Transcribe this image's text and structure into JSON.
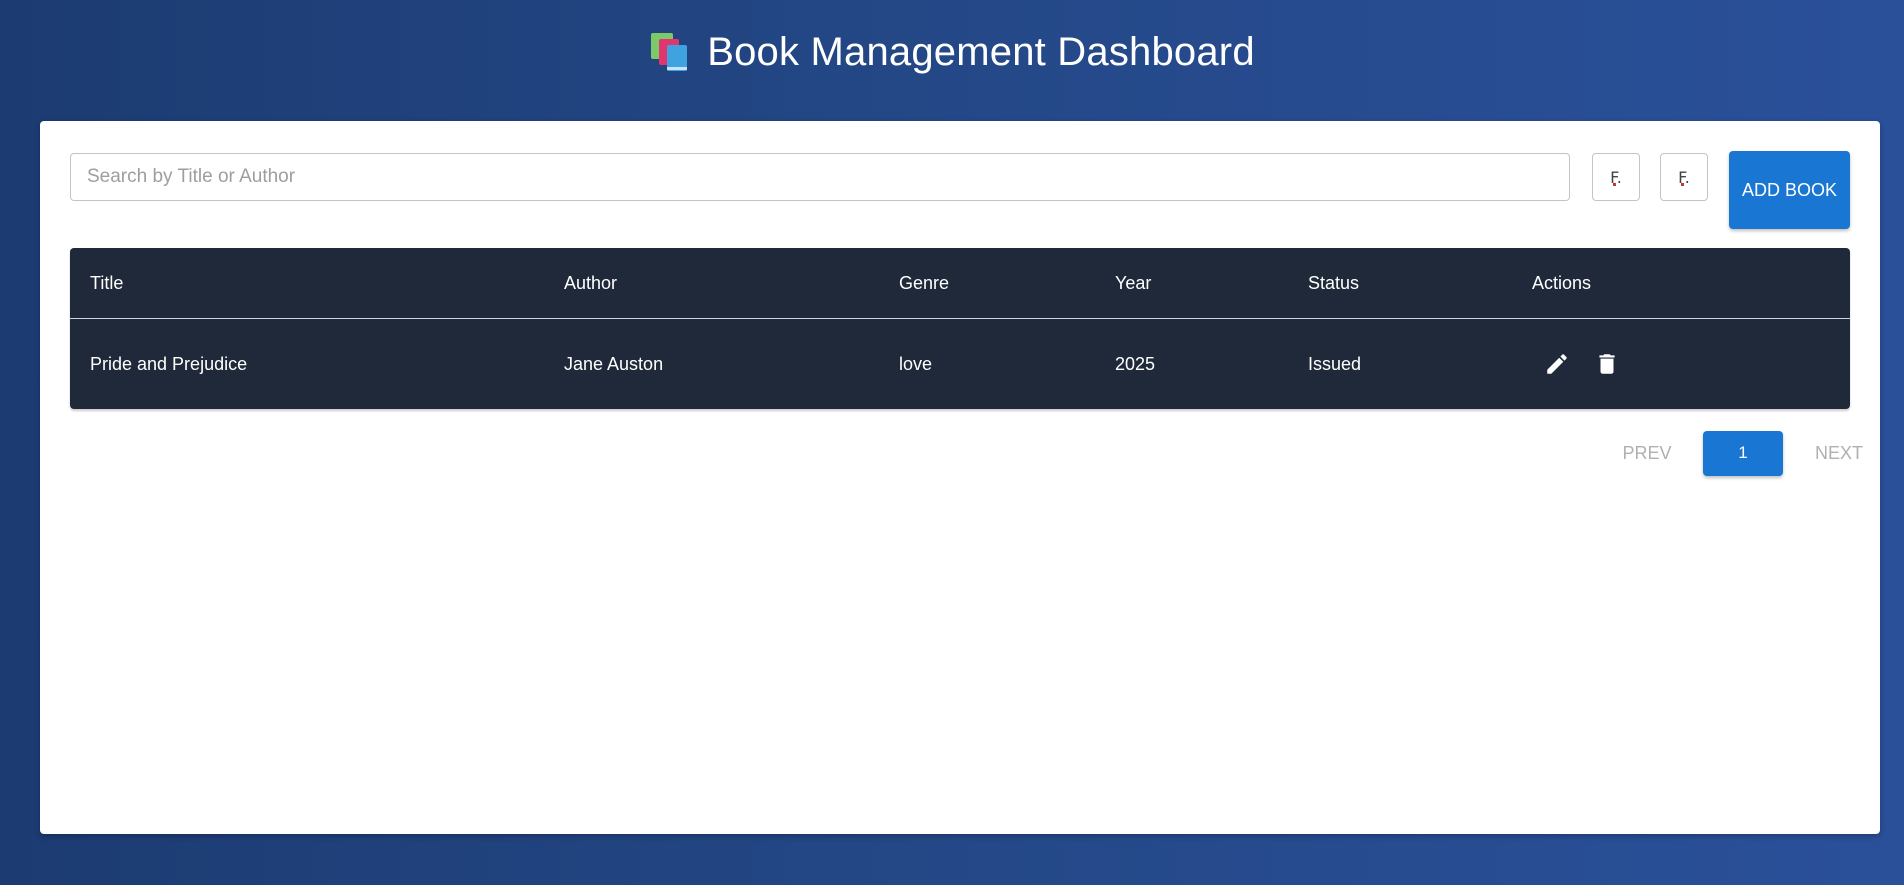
{
  "header": {
    "title": "Book Management Dashboard",
    "icon": "books-icon"
  },
  "toolbar": {
    "search_placeholder": "Search by Title or Author",
    "search_value": "",
    "filter1_label": "F.",
    "filter2_label": "F.",
    "add_label": "ADD BOOK"
  },
  "table": {
    "columns": [
      "Title",
      "Author",
      "Genre",
      "Year",
      "Status",
      "Actions"
    ],
    "rows": [
      {
        "title": "Pride and Prejudice",
        "author": "Jane Auston",
        "genre": "love",
        "year": "2025",
        "status": "Issued"
      }
    ]
  },
  "pagination": {
    "prev_label": "PREV",
    "current_page": "1",
    "next_label": "NEXT"
  },
  "colors": {
    "background": "#234687",
    "card": "#ffffff",
    "table_bg": "#1f2939",
    "accent": "#1976d2",
    "disabled_text": "#b0b0b0"
  }
}
